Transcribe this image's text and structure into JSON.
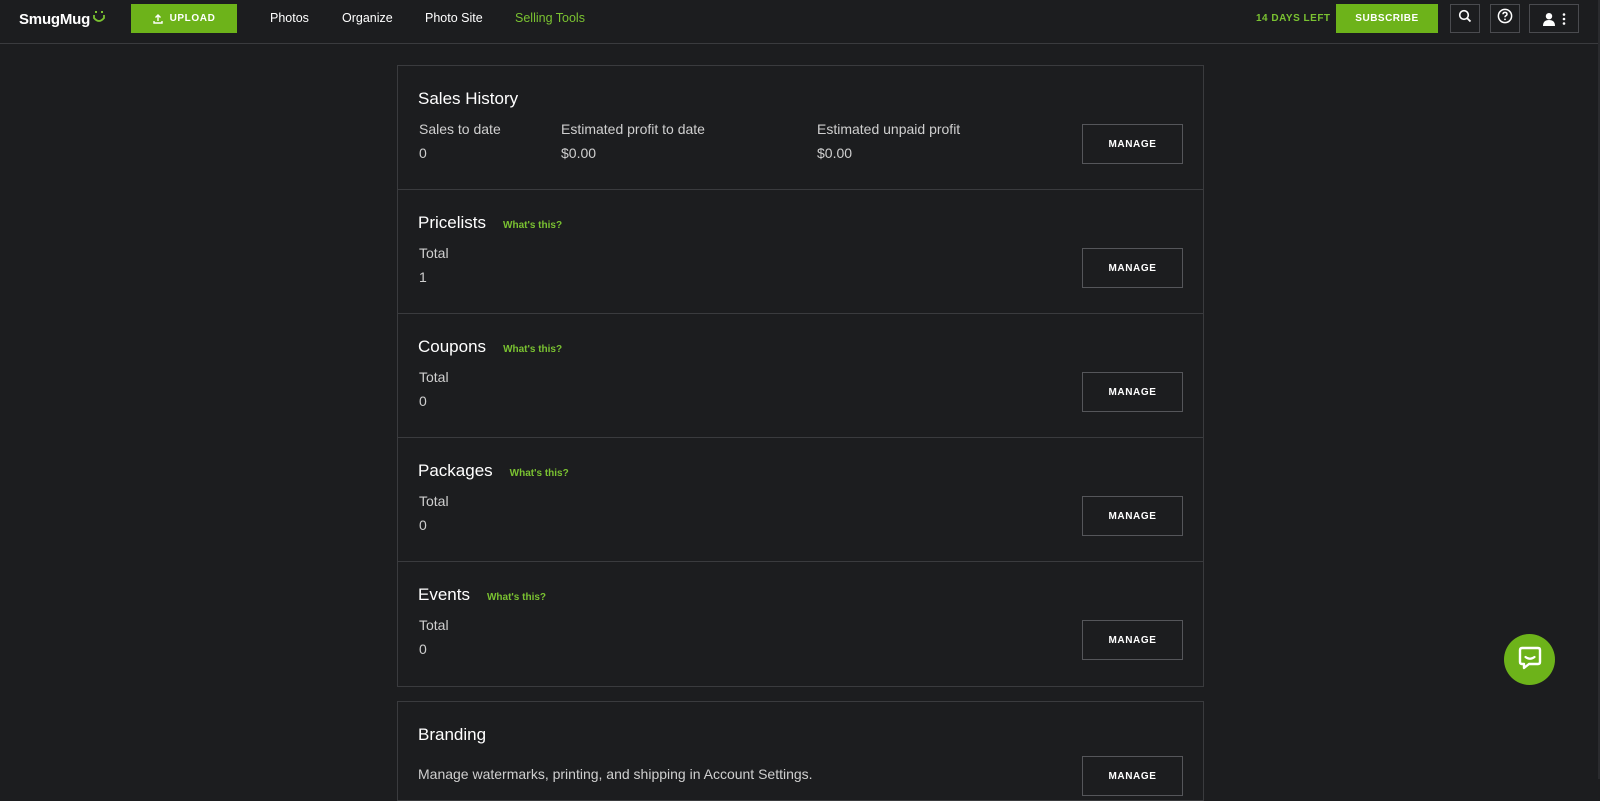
{
  "header": {
    "logo_text": "SmugMug",
    "upload_label": "UPLOAD",
    "nav": {
      "photos": "Photos",
      "organize": "Organize",
      "photo_site": "Photo Site",
      "selling_tools": "Selling Tools"
    },
    "trial_text": "14 DAYS LEFT",
    "subscribe_label": "SUBSCRIBE",
    "icons": [
      "search-icon",
      "help-icon",
      "user-icon",
      "more-vertical-icon"
    ]
  },
  "colors": {
    "accent": "#6db31a",
    "accent_text": "#7ac231",
    "background": "#1c1d1f",
    "border": "#3a3b3e"
  },
  "sales_history": {
    "title": "Sales History",
    "stats": [
      {
        "label": "Sales to date",
        "value": "0"
      },
      {
        "label": "Estimated profit to date",
        "value": "$0.00"
      },
      {
        "label": "Estimated unpaid profit",
        "value": "$0.00"
      }
    ],
    "manage_label": "MANAGE"
  },
  "pricelists": {
    "title": "Pricelists",
    "whats_this": "What's this?",
    "total_label": "Total",
    "total_value": "1",
    "manage_label": "MANAGE"
  },
  "coupons": {
    "title": "Coupons",
    "whats_this": "What's this?",
    "total_label": "Total",
    "total_value": "0",
    "manage_label": "MANAGE"
  },
  "packages": {
    "title": "Packages",
    "whats_this": "What's this?",
    "total_label": "Total",
    "total_value": "0",
    "manage_label": "MANAGE"
  },
  "events": {
    "title": "Events",
    "whats_this": "What's this?",
    "total_label": "Total",
    "total_value": "0",
    "manage_label": "MANAGE"
  },
  "branding": {
    "title": "Branding",
    "description": "Manage watermarks, printing, and shipping in Account Settings.",
    "manage_label": "MANAGE"
  },
  "chat": {
    "icon": "chat-bubble-icon"
  }
}
